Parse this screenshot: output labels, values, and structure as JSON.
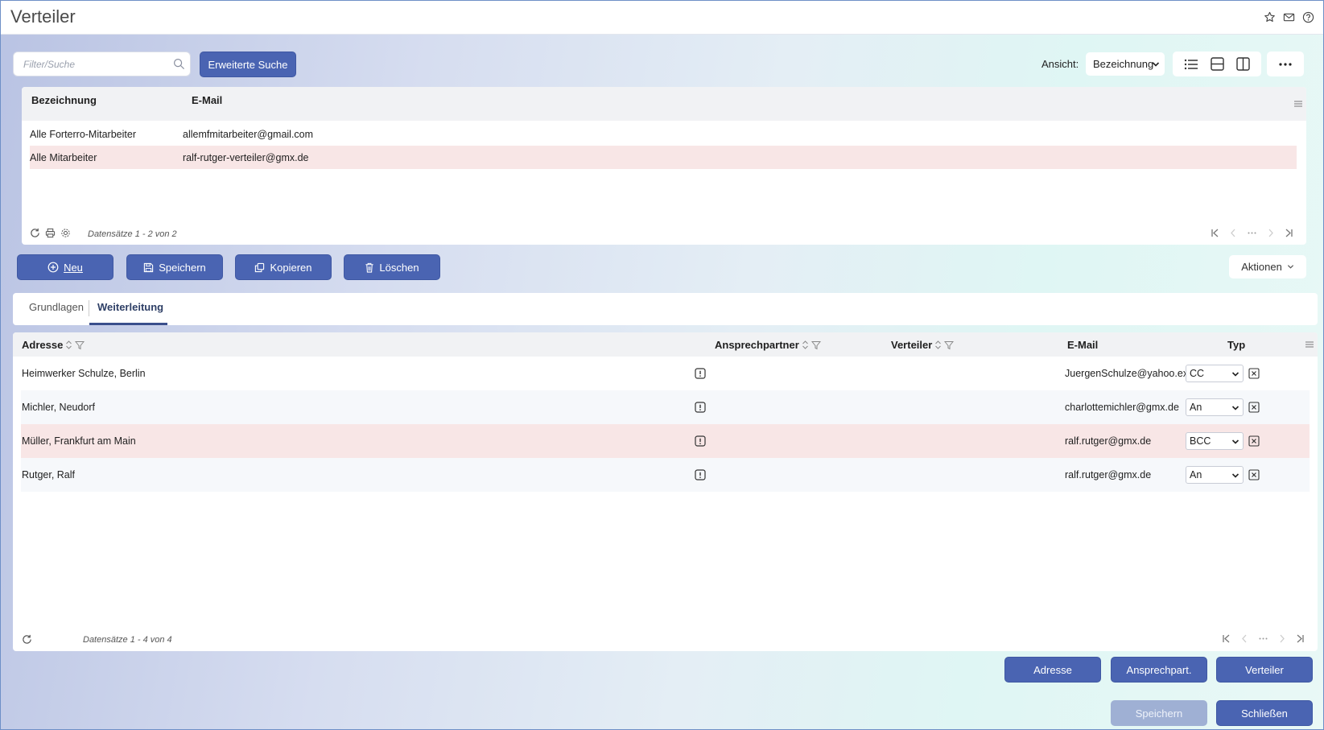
{
  "window": {
    "title": "Verteiler"
  },
  "title_icons": [
    "star-icon",
    "mail-icon",
    "help-icon"
  ],
  "search": {
    "placeholder": "Filter/Suche",
    "value": "",
    "advanced_label": "Erweiterte Suche"
  },
  "view": {
    "label": "Ansicht:",
    "selected": "Bezeichnung"
  },
  "top_grid": {
    "columns": [
      "Bezeichnung",
      "E-Mail"
    ],
    "rows": [
      {
        "bezeichnung": "Alle Forterro-Mitarbeiter",
        "email": "allemfmitarbeiter@gmail.com"
      },
      {
        "bezeichnung": "Alle Mitarbeiter",
        "email": "ralf-rutger-verteiler@gmx.de",
        "selected": true
      }
    ],
    "record_info": "Datensätze 1 - 2 von 2"
  },
  "actions": {
    "new": "Neu",
    "save": "Speichern",
    "copy": "Kopieren",
    "delete": "Löschen",
    "more": "Aktionen"
  },
  "tabs": [
    {
      "label": "Grundlagen",
      "active": false
    },
    {
      "label": "Weiterleitung",
      "active": true
    }
  ],
  "bottom_grid": {
    "columns": {
      "adresse": "Adresse",
      "ansprechpartner": "Ansprechpartner",
      "verteiler": "Verteiler",
      "email": "E-Mail",
      "typ": "Typ"
    },
    "rows": [
      {
        "adresse": "Heimwerker Schulze, Berlin",
        "email": "JuergenSchulze@yahoo.exp",
        "typ": "CC"
      },
      {
        "adresse": "Michler, Neudorf",
        "email": "charlottemichler@gmx.de",
        "typ": "An"
      },
      {
        "adresse": "Müller, Frankfurt am Main",
        "email": "ralf.rutger@gmx.de",
        "typ": "BCC",
        "selected": true
      },
      {
        "adresse": "Rutger, Ralf",
        "email": "ralf.rutger@gmx.de",
        "typ": "An"
      }
    ],
    "record_info": "Datensätze 1 - 4 von 4"
  },
  "add_buttons": {
    "address": "Adresse",
    "contact": "Ansprechpart.",
    "distributor": "Verteiler"
  },
  "footer_buttons": {
    "save": "Speichern",
    "close": "Schließen"
  },
  "colors": {
    "primary": "#4a64b2",
    "selected_row": "#f8e6e6",
    "disabled": "#9fb0d4"
  }
}
